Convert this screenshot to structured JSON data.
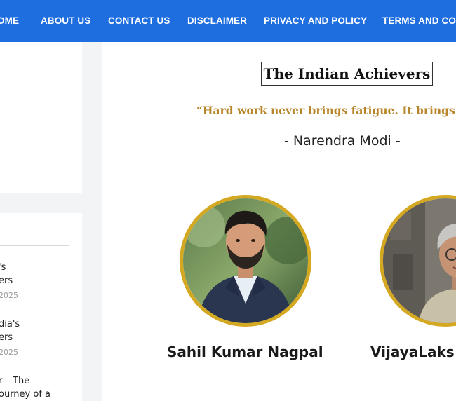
{
  "nav": {
    "items": [
      {
        "label": "OME"
      },
      {
        "label": "ABOUT US"
      },
      {
        "label": "CONTACT US"
      },
      {
        "label": "DISCLAIMER"
      },
      {
        "label": "PRIVACY AND POLICY"
      },
      {
        "label": "TERMS AND CON"
      }
    ]
  },
  "sidebar": {
    "posts": [
      {
        "title_line1": "'s",
        "title_line2": "ers",
        "date": "2025"
      },
      {
        "title_line1": "dia's",
        "title_line2": "ers",
        "date": "2025"
      },
      {
        "title_line1": "r – The",
        "title_line2": "ourney of a",
        "date": ""
      }
    ]
  },
  "main": {
    "site_title": "The Indian Achievers",
    "quote": "“Hard work never brings fatigue. It brings satisf",
    "quote_author": "- Narendra Modi -",
    "achievers": [
      {
        "name": "Sahil Kumar Nagpal"
      },
      {
        "name": "VijayaLaks"
      }
    ]
  },
  "colors": {
    "nav_background": "#1e6ee0",
    "quote": "#b8862a",
    "avatar_ring": "#d4a820"
  }
}
